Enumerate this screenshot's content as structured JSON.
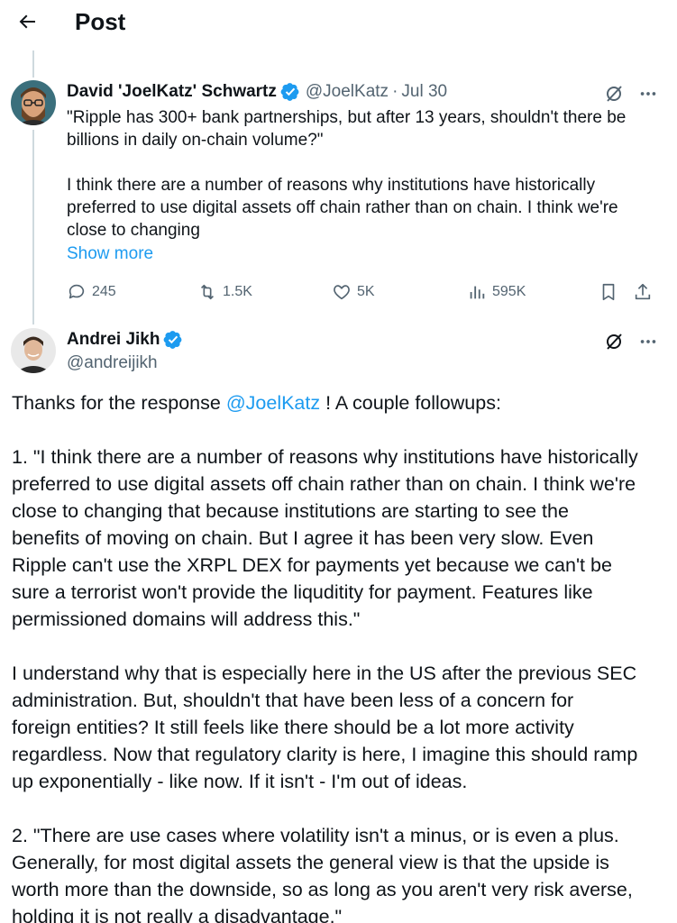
{
  "header": {
    "title": "Post",
    "back_icon": "arrow-left-icon"
  },
  "quoted_tweet": {
    "display_name": "David 'JoelKatz' Schwartz",
    "handle": "@JoelKatz",
    "separator": "·",
    "date": "Jul 30",
    "text_lines": [
      "\"Ripple has 300+ bank partnerships, but after 13 years, shouldn't there be",
      "billions in daily on-chain volume?\"",
      "",
      "I think there are a number of reasons why institutions have historically",
      "preferred to use digital assets off chain rather than on chain. I think we're",
      "close to changing"
    ],
    "show_more": "Show more",
    "stats": {
      "replies": "245",
      "reposts": "1.5K",
      "likes": "5K",
      "views": "595K"
    }
  },
  "reply_tweet": {
    "display_name": "Andrei Jikh",
    "handle": "@andreijikh",
    "intro_prefix": "Thanks for the response ",
    "intro_mention": "@JoelKatz",
    "intro_suffix": " ! A couple followups:",
    "body_lines": [
      "1. \"I think there are a number of reasons why institutions have historically",
      "preferred to use digital assets off chain rather than on chain. I think we're",
      "close to changing that because institutions are starting to see the",
      "benefits of moving on chain. But I agree it has been very slow. Even",
      "Ripple can't use the XRPL DEX for payments yet because we can't be",
      "sure a terrorist won't provide the liquditity for payment. Features like",
      "permissioned domains will address this.\"",
      "",
      "I understand why that is especially here in the US after the previous SEC",
      "administration. But, shouldn't that have been less of a concern for",
      "foreign entities? It still feels like there should be a lot more activity",
      "regardless. Now that regulatory clarity is here, I imagine this should ramp",
      "up exponentially - like now. If it isn't - I'm out of ideas.",
      "",
      "2. \"There are use cases where volatility isn't a minus, or is even a plus.",
      "Generally, for most digital assets the general view is that the upside is",
      "worth more than the downside, so as long as you aren't very risk averse,",
      "holding it is not really a disadvantage.\""
    ]
  },
  "colors": {
    "accent": "#1d9bf0",
    "secondary_text": "#536471",
    "primary_text": "#0f1419"
  }
}
